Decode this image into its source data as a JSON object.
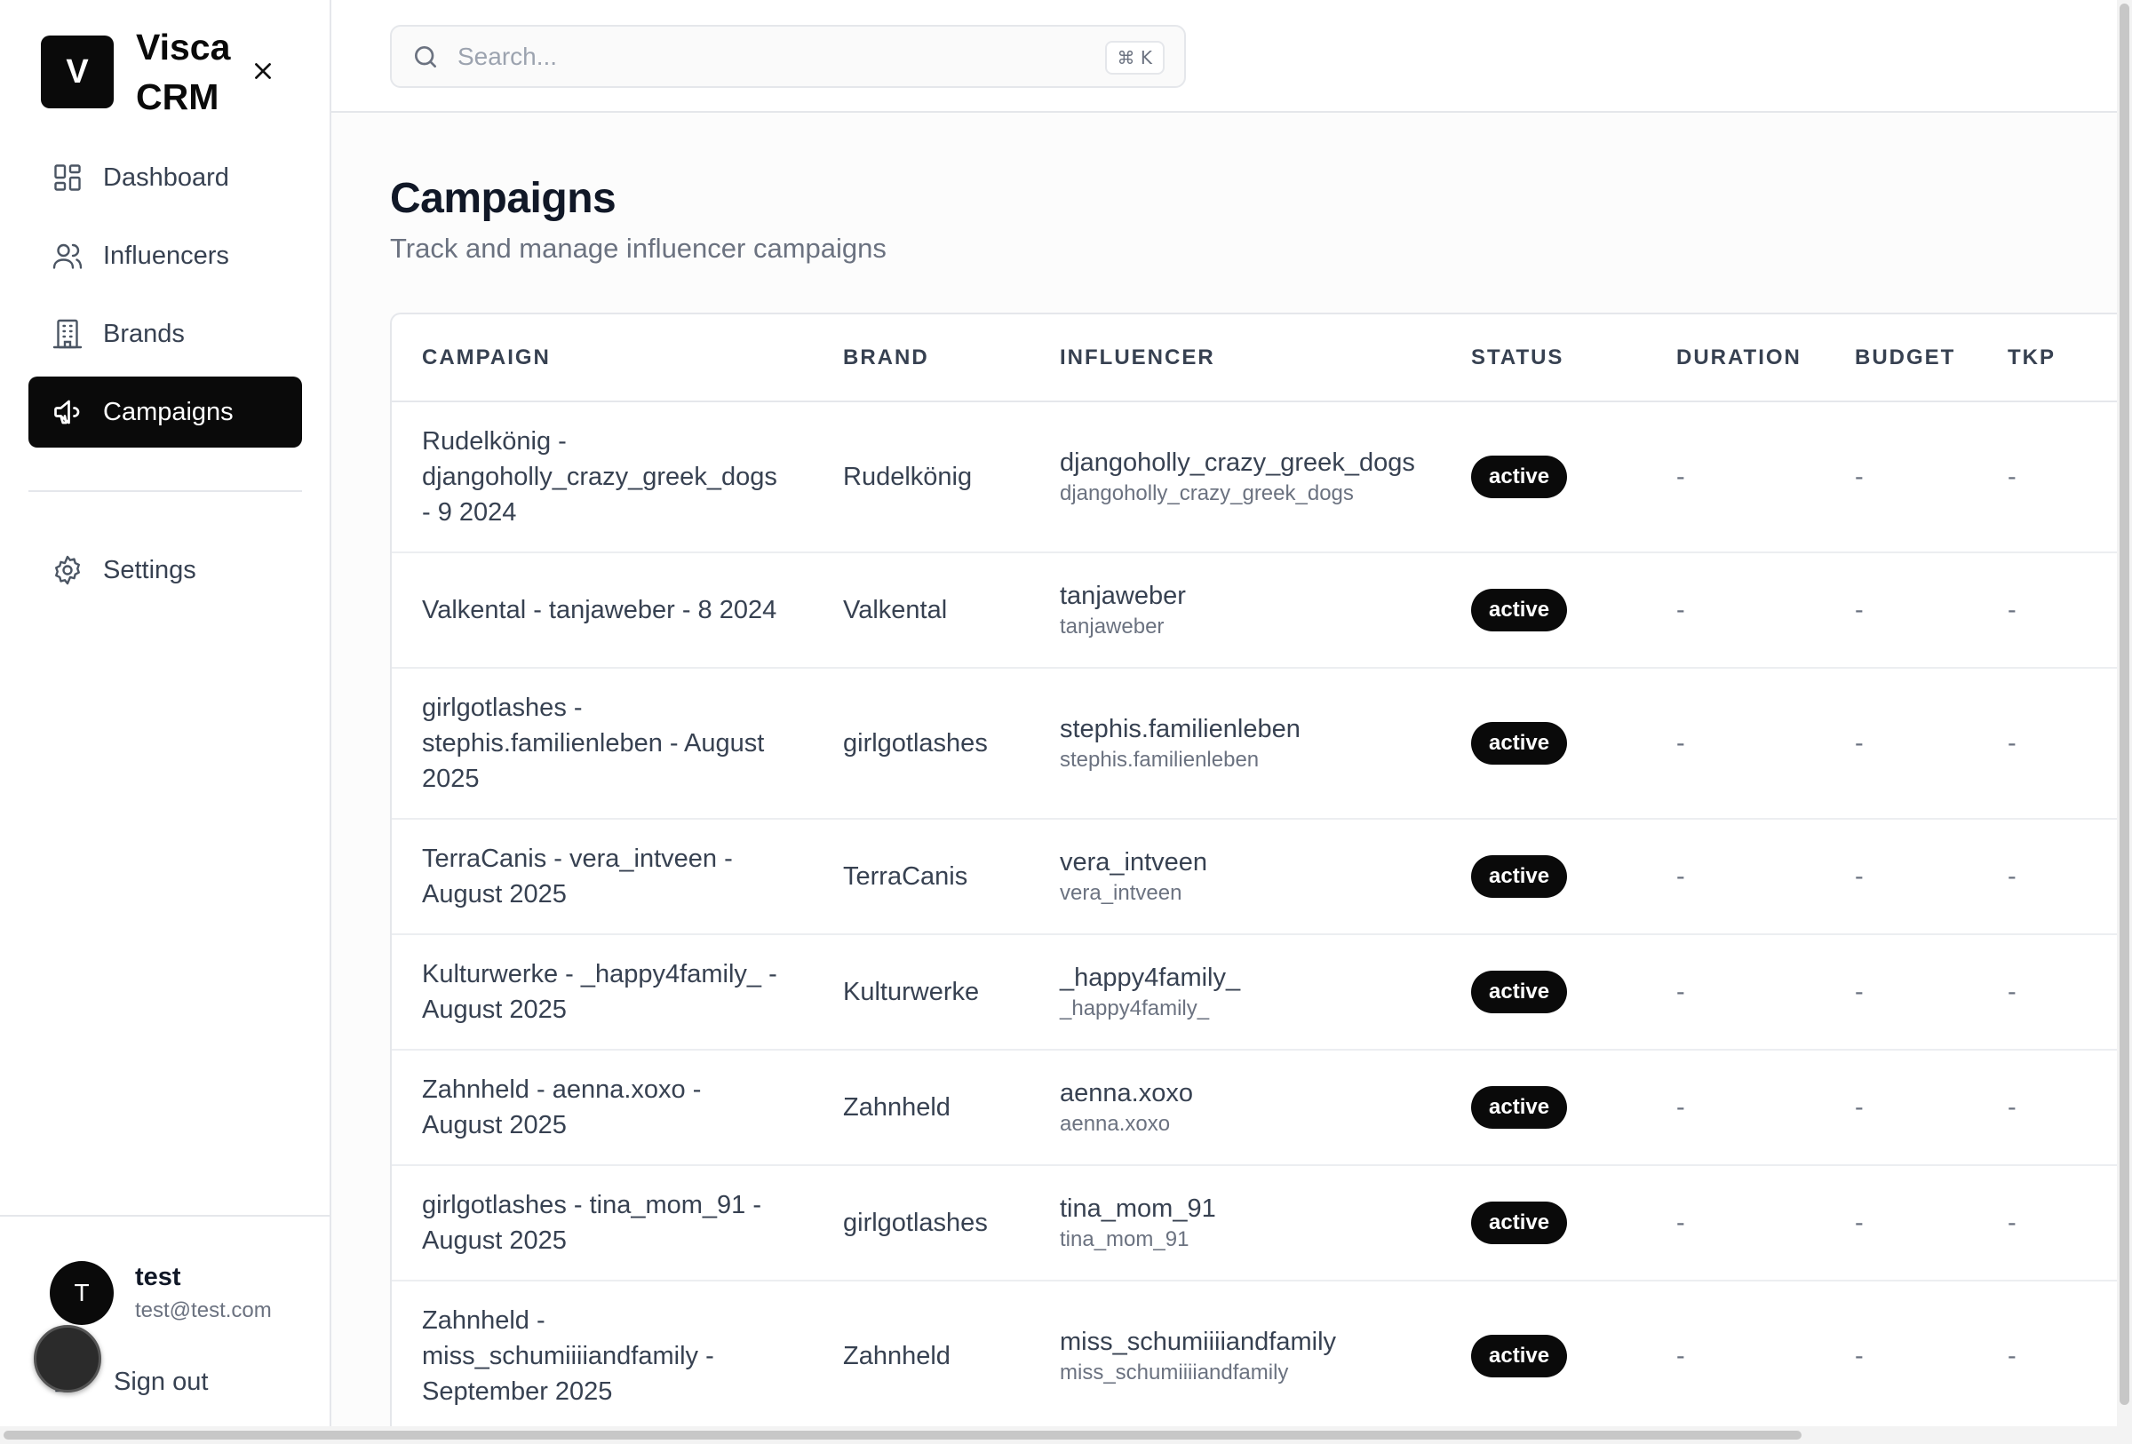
{
  "app": {
    "logo_letter": "V",
    "name": "Visca CRM"
  },
  "sidebar": {
    "items": [
      {
        "label": "Dashboard",
        "icon": "dashboard-icon"
      },
      {
        "label": "Influencers",
        "icon": "users-icon"
      },
      {
        "label": "Brands",
        "icon": "building-icon"
      },
      {
        "label": "Campaigns",
        "icon": "megaphone-icon",
        "active": true
      }
    ],
    "settings_label": "Settings"
  },
  "user": {
    "avatar_letter": "T",
    "name": "test",
    "email": "test@test.com",
    "signout_label": "Sign out"
  },
  "search": {
    "placeholder": "Search...",
    "shortcut": "⌘ K"
  },
  "page": {
    "title": "Campaigns",
    "subtitle": "Track and manage influencer campaigns"
  },
  "table": {
    "headers": [
      "CAMPAIGN",
      "BRAND",
      "INFLUENCER",
      "STATUS",
      "DURATION",
      "BUDGET",
      "TKP"
    ],
    "rows": [
      {
        "campaign": "Rudelkönig - djangoholly_crazy_greek_dogs - 9 2024",
        "brand": "Rudelkönig",
        "influencer": "djangoholly_crazy_greek_dogs",
        "influencer_sub": "djangoholly_crazy_greek_dogs",
        "status": "active",
        "duration": "-",
        "budget": "-",
        "tkp": "-"
      },
      {
        "campaign": "Valkental - tanjaweber - 8 2024",
        "brand": "Valkental",
        "influencer": "tanjaweber",
        "influencer_sub": "tanjaweber",
        "status": "active",
        "duration": "-",
        "budget": "-",
        "tkp": "-"
      },
      {
        "campaign": "girlgotlashes - stephis.familienleben - August 2025",
        "brand": "girlgotlashes",
        "influencer": "stephis.familienleben",
        "influencer_sub": "stephis.familienleben",
        "status": "active",
        "duration": "-",
        "budget": "-",
        "tkp": "-"
      },
      {
        "campaign": "TerraCanis - vera_intveen - August 2025",
        "brand": "TerraCanis",
        "influencer": "vera_intveen",
        "influencer_sub": "vera_intveen",
        "status": "active",
        "duration": "-",
        "budget": "-",
        "tkp": "-"
      },
      {
        "campaign": "Kulturwerke - _happy4family_ - August 2025",
        "brand": "Kulturwerke",
        "influencer": "_happy4family_",
        "influencer_sub": "_happy4family_",
        "status": "active",
        "duration": "-",
        "budget": "-",
        "tkp": "-"
      },
      {
        "campaign": "Zahnheld - aenna.xoxo - August 2025",
        "brand": "Zahnheld",
        "influencer": "aenna.xoxo",
        "influencer_sub": "aenna.xoxo",
        "status": "active",
        "duration": "-",
        "budget": "-",
        "tkp": "-"
      },
      {
        "campaign": "girlgotlashes - tina_mom_91 - August 2025",
        "brand": "girlgotlashes",
        "influencer": "tina_mom_91",
        "influencer_sub": "tina_mom_91",
        "status": "active",
        "duration": "-",
        "budget": "-",
        "tkp": "-"
      },
      {
        "campaign": "Zahnheld - miss_schumiiiiandfamily - September 2025",
        "brand": "Zahnheld",
        "influencer": "miss_schumiiiiandfamily",
        "influencer_sub": "miss_schumiiiiandfamily",
        "status": "active",
        "duration": "-",
        "budget": "-",
        "tkp": "-"
      }
    ]
  },
  "colors": {
    "accent": "#0a0a0a",
    "text": "#374151",
    "muted": "#6b7280",
    "border": "#e5e7eb"
  }
}
